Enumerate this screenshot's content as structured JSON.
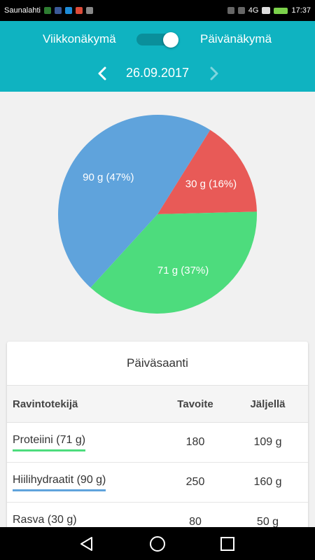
{
  "status_bar": {
    "carrier": "Saunalahti",
    "network": "4G",
    "time": "17:37"
  },
  "header": {
    "week_view_label": "Viikkonäkymä",
    "day_view_label": "Päivänäkymä",
    "toggle_state": "day",
    "date": "26.09.2017",
    "prev_icon": "chevron-left-icon",
    "next_icon": "chevron-right-icon",
    "background_color": "#0fb3c1"
  },
  "chart_data": {
    "type": "pie",
    "title": "",
    "slices": [
      {
        "name": "Rasva",
        "value": 30,
        "label": "30 g (16%)",
        "color": "#e85a57"
      },
      {
        "name": "Proteiini",
        "value": 71,
        "label": "71 g (37%)",
        "color": "#4ddc7d"
      },
      {
        "name": "Hiilihydraatit",
        "value": 90,
        "label": "90 g (47%)",
        "color": "#5fa3dc"
      }
    ]
  },
  "intake_table": {
    "title": "Päiväsaanti",
    "headers": [
      "Ravintotekijä",
      "Tavoite",
      "Jäljellä"
    ],
    "rows": [
      {
        "name": "Proteiini (71 g)",
        "goal": "180",
        "remaining": "109 g",
        "color": "#4ddc7d"
      },
      {
        "name": "Hiilihydraatit (90 g)",
        "goal": "250",
        "remaining": "160 g",
        "color": "#5fa3dc"
      },
      {
        "name": "Rasva (30 g)",
        "goal": "80",
        "remaining": "50 g",
        "color": "#e85a57"
      }
    ]
  },
  "nav_bar": {
    "back_icon": "back-triangle-icon",
    "home_icon": "home-circle-icon",
    "recents_icon": "recents-square-icon"
  }
}
